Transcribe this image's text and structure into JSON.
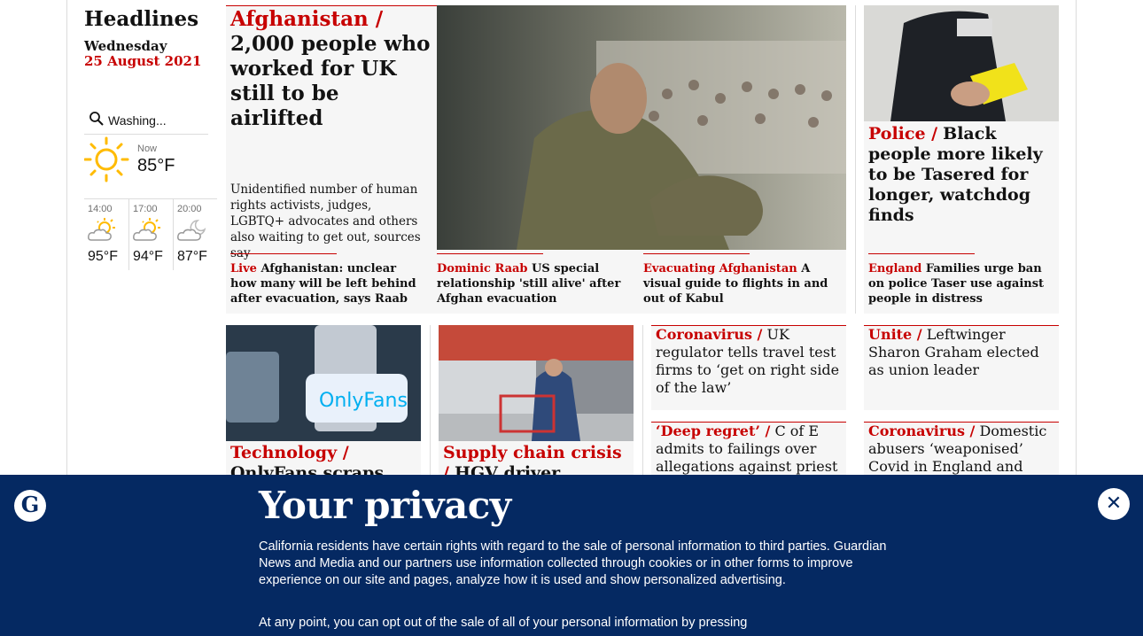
{
  "sidebar": {
    "title": "Headlines",
    "day": "Wednesday",
    "date": "25 August 2021",
    "weather": {
      "search_value": "Washing...",
      "now_label": "Now",
      "now_temp": "85°F",
      "forecast": [
        {
          "time": "14:00",
          "temp": "95°F",
          "icon": "sun-cloud-icon"
        },
        {
          "time": "17:00",
          "temp": "94°F",
          "icon": "sun-cloud-icon"
        },
        {
          "time": "20:00",
          "temp": "87°F",
          "icon": "moon-cloud-icon"
        }
      ]
    }
  },
  "lead": {
    "kicker": "Afghanistan /",
    "headline": "2,000 people who worked for UK still to be airlifted",
    "standfirst": "Unidentified number of human rights activists, judges, LGBTQ+ advocates and others also waiting to get out, sources say",
    "sublinks": [
      {
        "kicker": "Live",
        "text": "Afghanistan: unclear how many will be left behind after evacuation, says Raab"
      },
      {
        "kicker": "Dominic Raab",
        "text": "US special relationship 'still alive' after Afghan evacuation"
      },
      {
        "kicker": "Evacuating Afghanistan",
        "text": "A visual guide to flights in and out of Kabul"
      }
    ]
  },
  "police": {
    "kicker": "Police /",
    "headline": "Black people more likely to be Tasered for longer, watchdog finds",
    "sublink_kicker": "England",
    "sublink_text": "Families urge ban on police Taser use against people in distress"
  },
  "row2": [
    {
      "kicker": "Technology /",
      "headline": "OnlyFans scraps plans"
    },
    {
      "kicker": "Supply chain crisis /",
      "headline": "HGV driver shortages"
    },
    {
      "kicker": "Coronavirus /",
      "headline": "UK regulator tells travel test firms to ‘get on right side of the law’"
    },
    {
      "kicker": "Unite /",
      "headline": "Leftwinger Sharon Graham elected as union leader"
    },
    {
      "kicker": "‘Deep regret’ /",
      "headline": "C of E admits to failings over allegations against priest"
    },
    {
      "kicker": "Coronavirus /",
      "headline": "Domestic abusers ‘weaponised’ Covid in England and"
    }
  ],
  "privacy": {
    "title": "Your privacy",
    "body1": "California residents have certain rights with regard to the sale of personal information to third parties. Guardian News and Media and our partners use information collected through cookies or in other forms to improve experience on our site and pages, analyze how it is used and show personalized advertising.",
    "body2": "At any point, you can opt out of the sale of all of your personal information by pressing"
  },
  "colors": {
    "accent": "#c70000",
    "brand": "#052962",
    "card_bg": "#f6f6f6"
  }
}
